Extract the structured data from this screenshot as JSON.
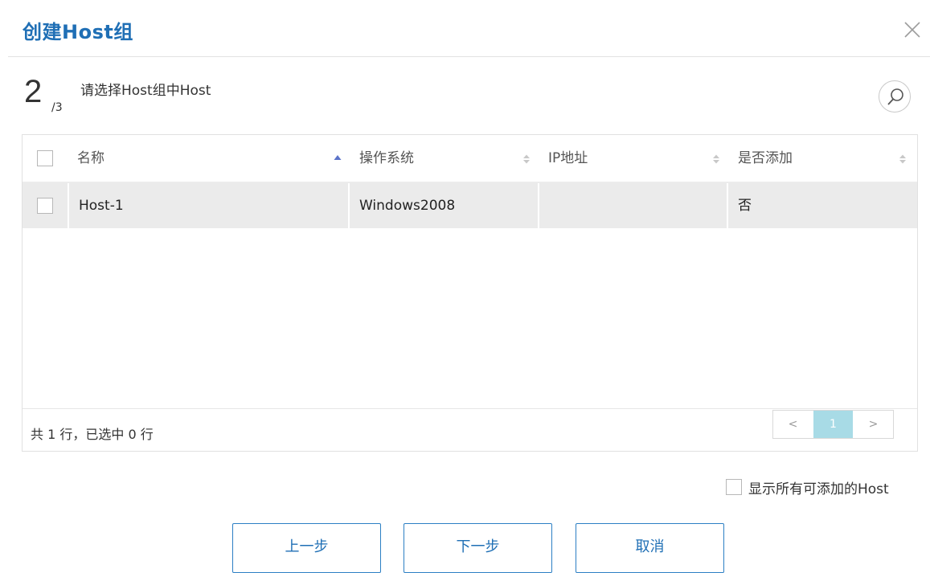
{
  "dialog": {
    "title": "创建Host组"
  },
  "step": {
    "current": "2",
    "total": "/3",
    "description": "请选择Host组中Host"
  },
  "table": {
    "columns": [
      "名称",
      "操作系统",
      "IP地址",
      "是否添加"
    ],
    "sort": {
      "column": "名称",
      "direction": "asc"
    },
    "rows": [
      {
        "name": "Host-1",
        "os": "Windows2008",
        "ip": "",
        "added": "否"
      }
    ],
    "footer_text": "共 1 行，已选中 0 行",
    "pagination": {
      "prev": "<",
      "current": "1",
      "next": ">"
    }
  },
  "show_all": {
    "label": "显示所有可添加的Host",
    "checked": false
  },
  "buttons": {
    "prev": "上一步",
    "next": "下一步",
    "cancel": "取消"
  },
  "colors": {
    "accent": "#1f6fb5",
    "page_highlight": "#a8dbe6",
    "row_bg": "#ebebeb"
  }
}
